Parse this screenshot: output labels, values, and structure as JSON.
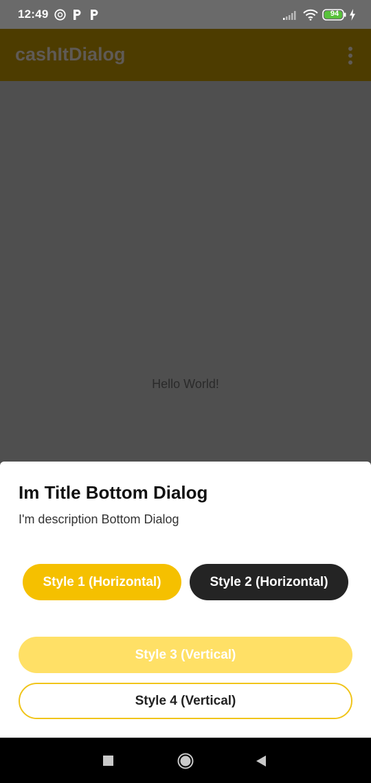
{
  "status_bar": {
    "time": "12:49",
    "battery": "94",
    "icons": [
      "vpn-icon",
      "p-icon",
      "p-icon",
      "signal-icon",
      "wifi-icon",
      "battery-icon",
      "charging-icon"
    ]
  },
  "app_bar": {
    "title": "cashItDialog",
    "menu_icon": "kebab-menu-icon"
  },
  "content": {
    "text": "Hello World!"
  },
  "dialog": {
    "title": "Im Title Bottom Dialog",
    "description": "I'm description Bottom Dialog",
    "buttons": {
      "style1": "Style 1 (Horizontal)",
      "style2": "Style 2 (Horizontal)",
      "style3": "Style 3 (Vertical)",
      "style4": "Style 4 (Vertical)"
    }
  },
  "colors": {
    "accent": "#f5c000",
    "dark_button": "#242424",
    "light_accent": "#ffe066",
    "outline": "#f0c419"
  }
}
